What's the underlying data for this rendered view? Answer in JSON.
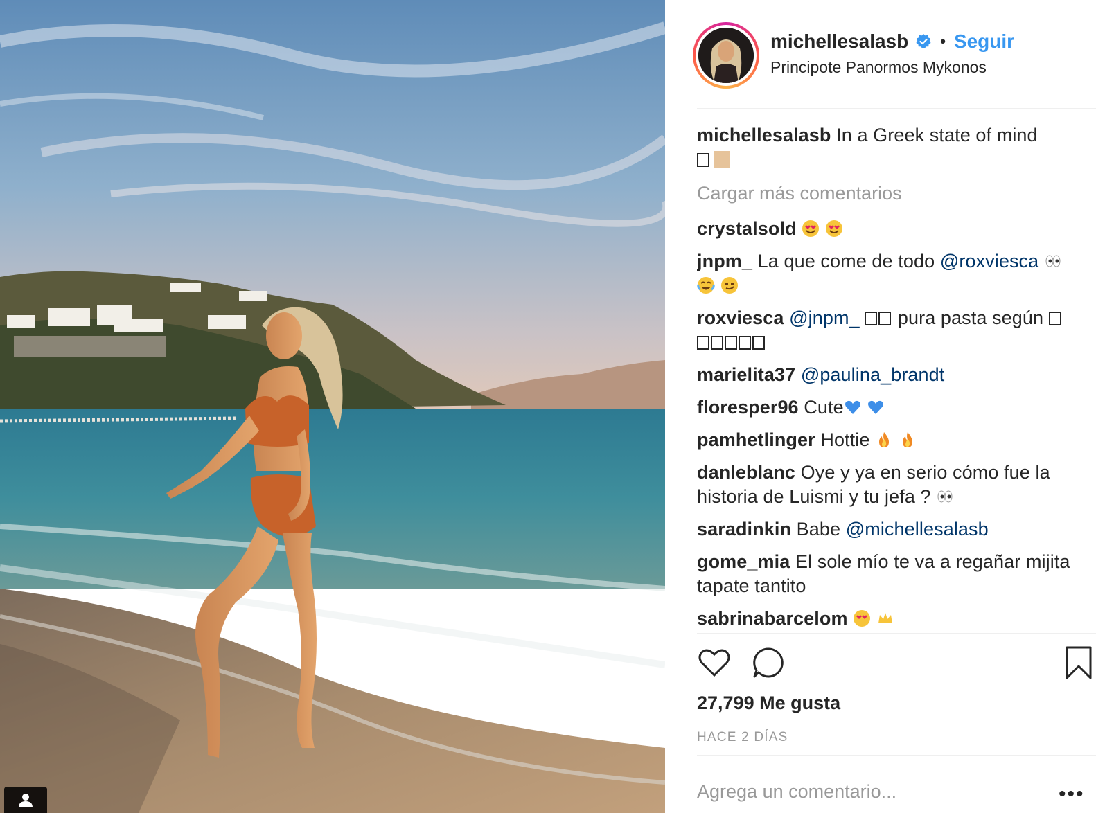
{
  "post": {
    "username": "michellesalasb",
    "follow_label": "Seguir",
    "separator": "•",
    "location": "Principote Panormos Mykonos",
    "caption_user": "michellesalasb",
    "caption_text": "In a Greek state of mind",
    "load_more": "Cargar más comentarios",
    "likes": "27,799 Me gusta",
    "time": "HACE 2 DÍAS",
    "add_comment_placeholder": "Agrega un comentario...",
    "more_label": "•••"
  },
  "comments": [
    {
      "user": "crystalsold",
      "text": "",
      "emojis": [
        "heart-eyes",
        "heart-eyes"
      ]
    },
    {
      "user": "jnpm_",
      "text": "La que come de todo",
      "mention": "@roxviesca",
      "emojis": [
        "eyes",
        "joy",
        "smirk"
      ]
    },
    {
      "user": "roxviesca",
      "mention": "@jnpm_",
      "text": "pura pasta según"
    },
    {
      "user": "marielita37",
      "mention": "@paulina_brandt"
    },
    {
      "user": "floresper96",
      "text": "Cute",
      "emojis": [
        "blue-heart",
        "blue-heart"
      ]
    },
    {
      "user": "pamhetlinger",
      "text": "Hottie",
      "emojis": [
        "fire",
        "fire"
      ]
    },
    {
      "user": "danleblanc",
      "text": "Oye y ya en serio cómo fue la historia de Luismi y tu jefa ?",
      "emojis": [
        "eyes"
      ]
    },
    {
      "user": "saradinkin",
      "text": "Babe",
      "mention": "@michellesalasb"
    },
    {
      "user": "gome_mia",
      "text": "El sole mío te va a regañar mijita tapate tantito"
    },
    {
      "user": "sabrinabarcelom",
      "emojis": [
        "heart-eyes",
        "crown"
      ]
    }
  ],
  "icons": {
    "verified": "verified-badge-icon",
    "like": "heart-icon",
    "comment": "speech-bubble-icon",
    "save": "bookmark-icon",
    "tag": "user-tag-icon"
  },
  "colors": {
    "accent": "#3897f0",
    "mention": "#003569",
    "muted": "#999999",
    "text": "#262626"
  }
}
